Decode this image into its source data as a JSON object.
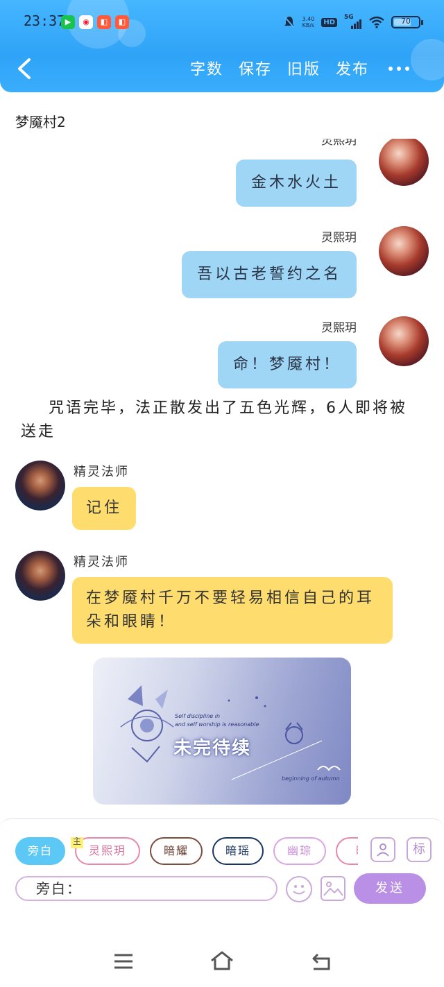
{
  "status_bar": {
    "time": "23:37",
    "net_speed_value": "3.40",
    "net_speed_unit": "KB/s",
    "hd_label": "HD",
    "network_label": "5G",
    "battery_level": "70"
  },
  "nav": {
    "actions": [
      "字数",
      "保存",
      "旧版",
      "发布"
    ]
  },
  "chat": {
    "title": "梦魇村2",
    "messages": [
      {
        "name": "灵熙玥",
        "text": "金木水火土"
      },
      {
        "name": "灵熙玥",
        "text": "吾以古老誓约之名"
      },
      {
        "name": "灵熙玥",
        "text": "命！梦魇村！"
      },
      {
        "narration": "咒语完毕，法正散发出了五色光辉，6人即将被送走"
      },
      {
        "name": "精灵法师",
        "text": "记住"
      },
      {
        "name": "精灵法师",
        "text": "在梦魇村千万不要轻易相信自己的耳朵和眼睛！"
      }
    ],
    "image_text": "未完待续",
    "image_small_text_1": "Self discipline in",
    "image_small_text_2": "and self worship is reasonable",
    "image_small_text_3": "beginning of autumn"
  },
  "composer": {
    "roles": [
      "旁白",
      "灵熙玥",
      "暗耀",
      "暗瑶",
      "幽琮",
      "暗"
    ],
    "main_tag": "主",
    "tool_person": "person-icon",
    "tool_tag": "标",
    "input_prefix": "旁白：",
    "send_label": "发送"
  },
  "colors": {
    "header": "#2fa3f7",
    "right_bubble": "#9fd5f5",
    "left_bubble": "#ffdc6e",
    "send": "#ba8fe6"
  }
}
